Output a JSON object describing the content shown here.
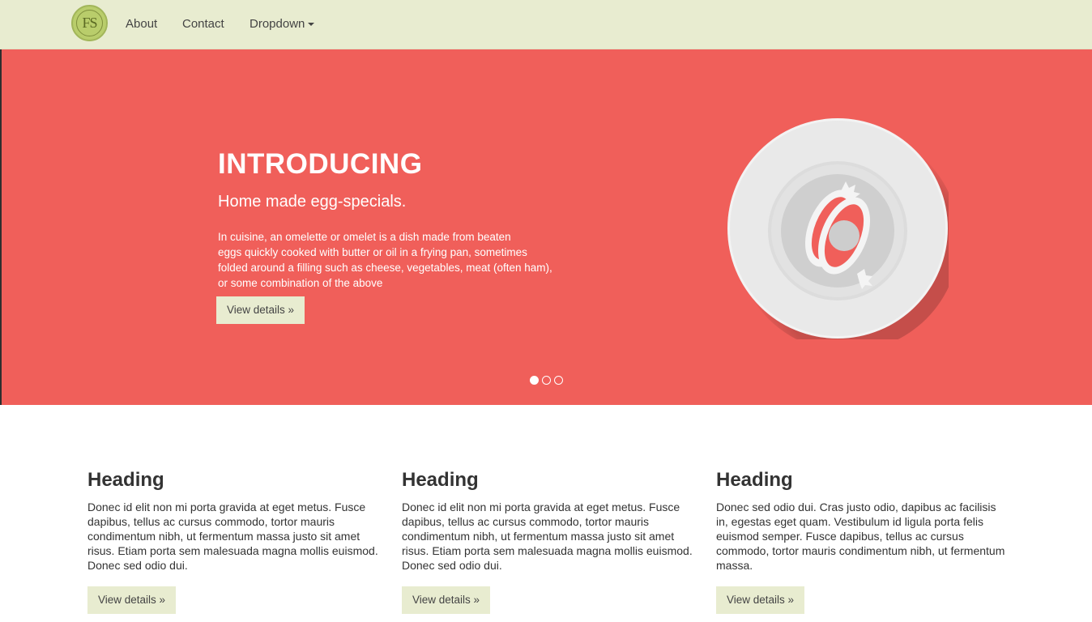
{
  "navbar": {
    "logo_text": "FS",
    "links": [
      {
        "label": "About"
      },
      {
        "label": "Contact"
      },
      {
        "label": "Dropdown"
      }
    ]
  },
  "hero": {
    "title": "INTRODUCING",
    "subtitle": "Home made egg-specials.",
    "description_lines": [
      "In cuisine, an omelette or omelet is a dish made from beaten",
      "eggs quickly cooked with butter or oil in a frying pan, sometimes",
      "folded around a filling such as cheese, vegetables, meat (often ham),",
      "or some combination of the above"
    ],
    "button_label": "View details »",
    "carousel": {
      "slide_count": 3,
      "active_index": 0
    },
    "image_icon": "egg-plate-icon"
  },
  "columns": [
    {
      "heading": "Heading",
      "text": "Donec id elit non mi porta gravida at eget metus. Fusce dapibus, tellus ac cursus commodo, tortor mauris condimentum nibh, ut fermentum massa justo sit amet risus. Etiam porta sem malesuada magna mollis euismod. Donec sed odio dui.",
      "button_label": "View details »"
    },
    {
      "heading": "Heading",
      "text": "Donec id elit non mi porta gravida at eget metus. Fusce dapibus, tellus ac cursus commodo, tortor mauris condimentum nibh, ut fermentum massa justo sit amet risus. Etiam porta sem malesuada magna mollis euismod. Donec sed odio dui.",
      "button_label": "View details »"
    },
    {
      "heading": "Heading",
      "text": "Donec sed odio dui. Cras justo odio, dapibus ac facilisis in, egestas eget quam. Vestibulum id ligula porta felis euismod semper. Fusce dapibus, tellus ac cursus commodo, tortor mauris condimentum nibh, ut fermentum massa.",
      "button_label": "View details »"
    }
  ],
  "colors": {
    "navbar_bg": "#e8ecd0",
    "hero_bg": "#f05f5a",
    "logo_green": "#b9cd6b",
    "button_bg": "#e8ecd0"
  }
}
